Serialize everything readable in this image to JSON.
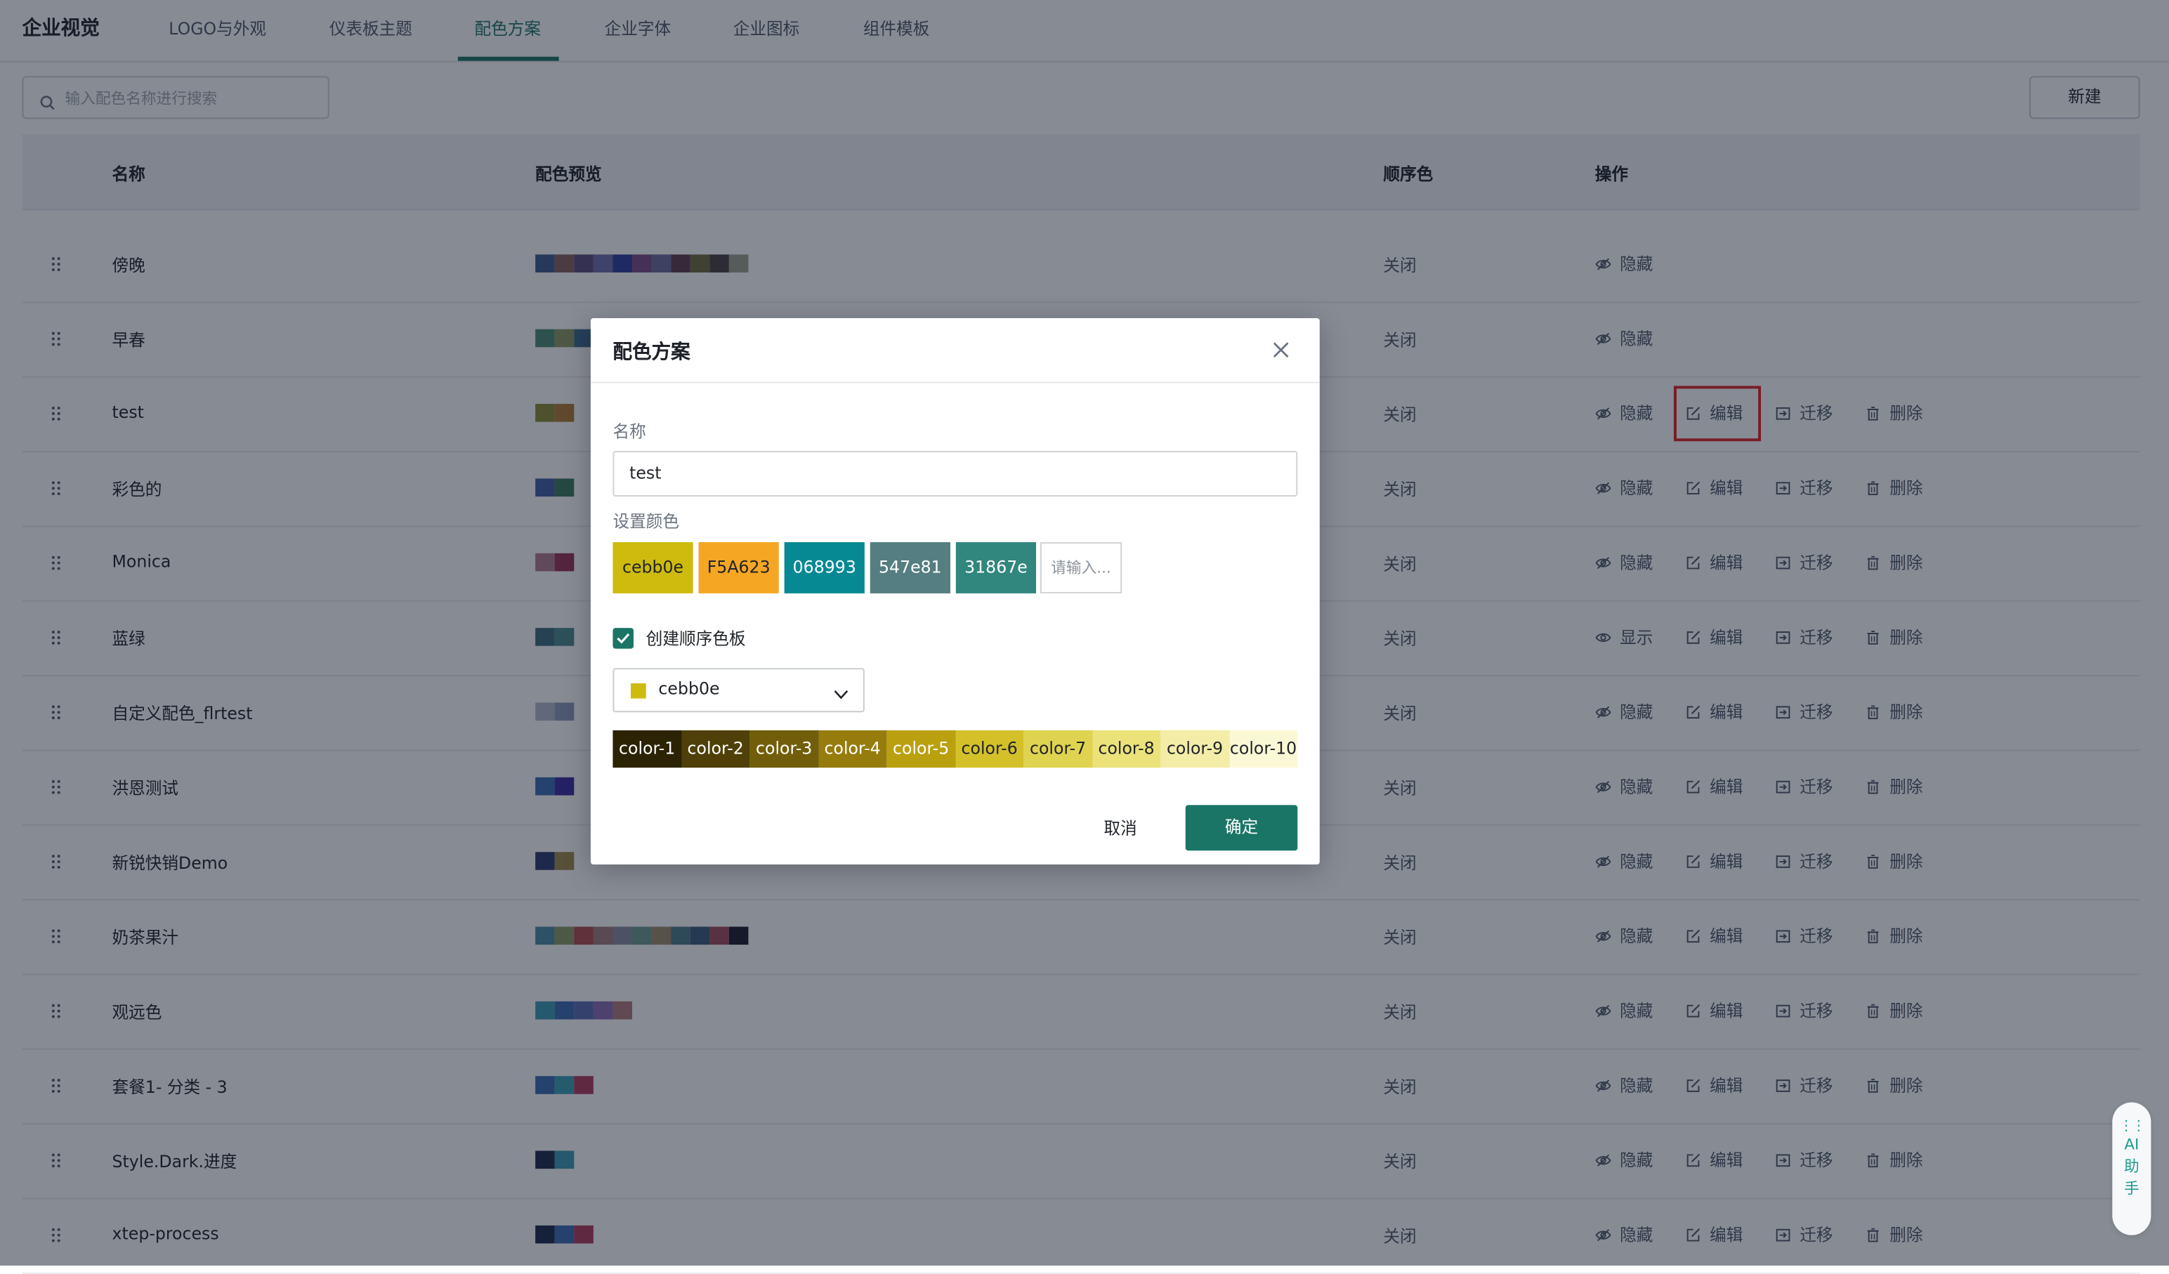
{
  "nav": {
    "brand": "企业视觉",
    "tabs": [
      {
        "label": "LOGO与外观"
      },
      {
        "label": "仪表板主题"
      },
      {
        "label": "配色方案"
      },
      {
        "label": "企业字体"
      },
      {
        "label": "企业图标"
      },
      {
        "label": "组件模板"
      }
    ],
    "active_tab": "配色方案"
  },
  "search": {
    "placeholder": "输入配色名称进行搜索"
  },
  "new_button": "新建",
  "table": {
    "headers": {
      "name": "名称",
      "preview": "配色预览",
      "sequential": "顺序色",
      "actions": "操作"
    },
    "action_labels": {
      "hide": "隐藏",
      "show": "显示",
      "edit": "编辑",
      "migrate": "迁移",
      "delete": "删除"
    },
    "rows": [
      {
        "name": "傍晚",
        "sequential": "关闭",
        "visibility": "隐藏",
        "colors": [
          "#3f5a8a",
          "#8b5f5a",
          "#5b4a7a",
          "#6a6fa8",
          "#2c3f9a",
          "#7a4b86",
          "#6b6a9a",
          "#5f3a4a",
          "#6f6b3a",
          "#4a4040",
          "#9aa08a"
        ]
      },
      {
        "name": "早春",
        "sequential": "关闭",
        "visibility": "隐藏",
        "colors": [
          "#4c8a70",
          "#8a9a60",
          "#3a6a8a"
        ]
      },
      {
        "name": "test",
        "sequential": "关闭",
        "visibility": "隐藏",
        "colors": [
          "#8a8a30",
          "#b07a30"
        ]
      },
      {
        "name": "彩色的",
        "sequential": "关闭",
        "visibility": "隐藏",
        "colors": [
          "#3f5fa0",
          "#3a7a5a"
        ]
      },
      {
        "name": "Monica",
        "sequential": "关闭",
        "visibility": "隐藏",
        "colors": [
          "#b07a8a",
          "#9a3050"
        ]
      },
      {
        "name": "蓝绿",
        "sequential": "关闭",
        "visibility": "显示",
        "colors": [
          "#3a6a7a",
          "#4a8a8a"
        ]
      },
      {
        "name": "自定义配色_flrtest",
        "sequential": "关闭",
        "visibility": "隐藏",
        "colors": [
          "#b0b8c8",
          "#8a9ab8"
        ]
      },
      {
        "name": "洪恩测试",
        "sequential": "关闭",
        "visibility": "隐藏",
        "colors": [
          "#3a6ab0",
          "#3a2aa0"
        ]
      },
      {
        "name": "新锐快销Demo",
        "sequential": "关闭",
        "visibility": "隐藏",
        "colors": [
          "#2a3a6a",
          "#a08a4a"
        ]
      },
      {
        "name": "奶茶果汁",
        "sequential": "关闭",
        "visibility": "隐藏",
        "colors": [
          "#4a8aa0",
          "#8a9a60",
          "#b04a4a",
          "#a07a7a",
          "#8a8aa0",
          "#6a9a8a",
          "#a08a6a",
          "#4a7a8a",
          "#3a5a7a",
          "#a04a5a",
          "#1a1a2a"
        ]
      },
      {
        "name": "观远色",
        "sequential": "关闭",
        "visibility": "隐藏",
        "colors": [
          "#3a9ab0",
          "#3a6ab0",
          "#5a6ab0",
          "#8a6ab0",
          "#b07a7a"
        ]
      },
      {
        "name": "套餐1- 分类 - 3",
        "sequential": "关闭",
        "visibility": "隐藏",
        "colors": [
          "#3a6ab0",
          "#3aa0b0",
          "#b03a5a"
        ]
      },
      {
        "name": "Style.Dark.进度",
        "sequential": "关闭",
        "visibility": "隐藏",
        "colors": [
          "#1a2a4a",
          "#3a9ab0"
        ]
      },
      {
        "name": "xtep-process",
        "sequential": "关闭",
        "visibility": "隐藏",
        "colors": [
          "#1a2a4a",
          "#3a6ab0",
          "#b03a5a"
        ]
      }
    ]
  },
  "dialog": {
    "title": "配色方案",
    "name_label": "名称",
    "name_value": "test",
    "colors_label": "设置颜色",
    "colors": [
      {
        "hex": "cebb0e",
        "bg": "#cebb0e",
        "fg": "#1f2329"
      },
      {
        "hex": "F5A623",
        "bg": "#F5A623",
        "fg": "#1f2329"
      },
      {
        "hex": "068993",
        "bg": "#068993",
        "fg": "#ffffff"
      },
      {
        "hex": "547e81",
        "bg": "#547e81",
        "fg": "#ffffff"
      },
      {
        "hex": "31867e",
        "bg": "#31867e",
        "fg": "#ffffff"
      }
    ],
    "color_input_placeholder": "请输入...",
    "sequential_checkbox_label": "创建顺序色板",
    "sequential_checked": true,
    "base_color": {
      "value": "cebb0e",
      "swatch": "#cebb0e"
    },
    "scale": [
      {
        "label": "color-1",
        "bg": "#2b2304",
        "fg": "#ffffff"
      },
      {
        "label": "color-2",
        "bg": "#4e4008",
        "fg": "#ffffff"
      },
      {
        "label": "color-3",
        "bg": "#725e0a",
        "fg": "#ffffff"
      },
      {
        "label": "color-4",
        "bg": "#967c0c",
        "fg": "#ffffff"
      },
      {
        "label": "color-5",
        "bg": "#baa00e",
        "fg": "#ffffff"
      },
      {
        "label": "color-6",
        "bg": "#d4c12a",
        "fg": "#1f2329"
      },
      {
        "label": "color-7",
        "bg": "#e0d34f",
        "fg": "#1f2329"
      },
      {
        "label": "color-8",
        "bg": "#ebe27a",
        "fg": "#1f2329"
      },
      {
        "label": "color-9",
        "bg": "#f4eda8",
        "fg": "#1f2329"
      },
      {
        "label": "color-10",
        "bg": "#fbf8d6",
        "fg": "#1f2329"
      }
    ],
    "cancel_label": "取消",
    "ok_label": "确定"
  },
  "ai_helper": {
    "line1": "AI",
    "line2": "助",
    "line3": "手"
  },
  "accent_color": "#1b7566"
}
